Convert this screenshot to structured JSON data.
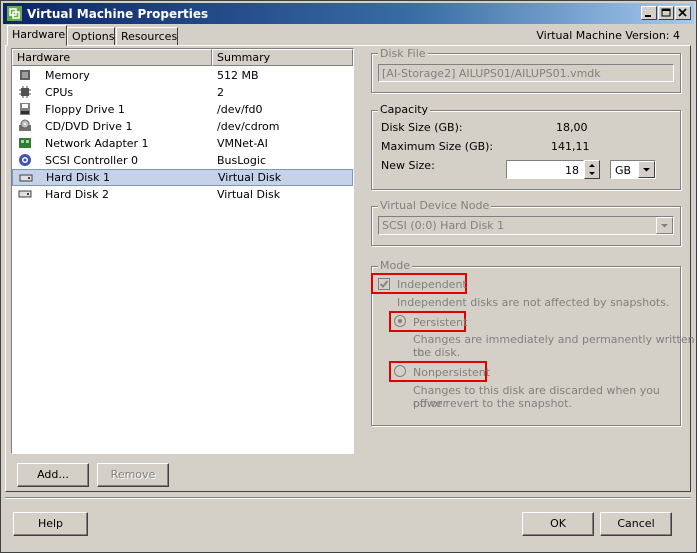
{
  "window": {
    "title": "Virtual Machine Properties",
    "version_label": "Virtual Machine Version: 4"
  },
  "tabs": [
    {
      "label": "Hardware"
    },
    {
      "label": "Options"
    },
    {
      "label": "Resources"
    }
  ],
  "hardware": {
    "columns": {
      "name": "Hardware",
      "summary": "Summary"
    },
    "items": [
      {
        "icon": "memory-icon",
        "name": "Memory",
        "summary": "512 MB"
      },
      {
        "icon": "cpu-icon",
        "name": "CPUs",
        "summary": "2"
      },
      {
        "icon": "floppy-icon",
        "name": "Floppy Drive 1",
        "summary": "/dev/fd0"
      },
      {
        "icon": "cdrom-icon",
        "name": "CD/DVD Drive 1",
        "summary": "/dev/cdrom"
      },
      {
        "icon": "network-adapter-icon",
        "name": "Network Adapter 1",
        "summary": "VMNet-AI"
      },
      {
        "icon": "scsi-controller-icon",
        "name": "SCSI Controller 0",
        "summary": "BusLogic"
      },
      {
        "icon": "hard-disk-icon",
        "name": "Hard Disk 1",
        "summary": "Virtual Disk"
      },
      {
        "icon": "hard-disk-icon",
        "name": "Hard Disk 2",
        "summary": "Virtual Disk"
      }
    ],
    "add_label": "Add...",
    "remove_label": "Remove"
  },
  "disk_file": {
    "label": "Disk File",
    "value": "[AI-Storage2] AILUPS01/AILUPS01.vmdk"
  },
  "capacity": {
    "label": "Capacity",
    "disk_size_label": "Disk Size (GB):",
    "disk_size_value": "18,00",
    "max_size_label": "Maximum Size (GB):",
    "max_size_value": "141,11",
    "new_size_label": "New Size:",
    "new_size_value": "18",
    "unit": "GB"
  },
  "virtual_device_node": {
    "label": "Virtual Device Node",
    "value": "SCSI (0:0) Hard Disk 1"
  },
  "mode": {
    "label": "Mode",
    "independent_label": "Independent",
    "independent_hint": "Independent disks are not affected by snapshots.",
    "persistent_label": "Persistent",
    "persistent_hint_1": "Changes are immediately and permanently written to",
    "persistent_hint_2": "the disk.",
    "nonpersistent_label": "Nonpersistent",
    "nonpersistent_hint_1": "Changes to this disk are discarded when you power",
    "nonpersistent_hint_2": "off or revert to the snapshot."
  },
  "footer": {
    "help_label": "Help",
    "ok_label": "OK",
    "cancel_label": "Cancel"
  }
}
